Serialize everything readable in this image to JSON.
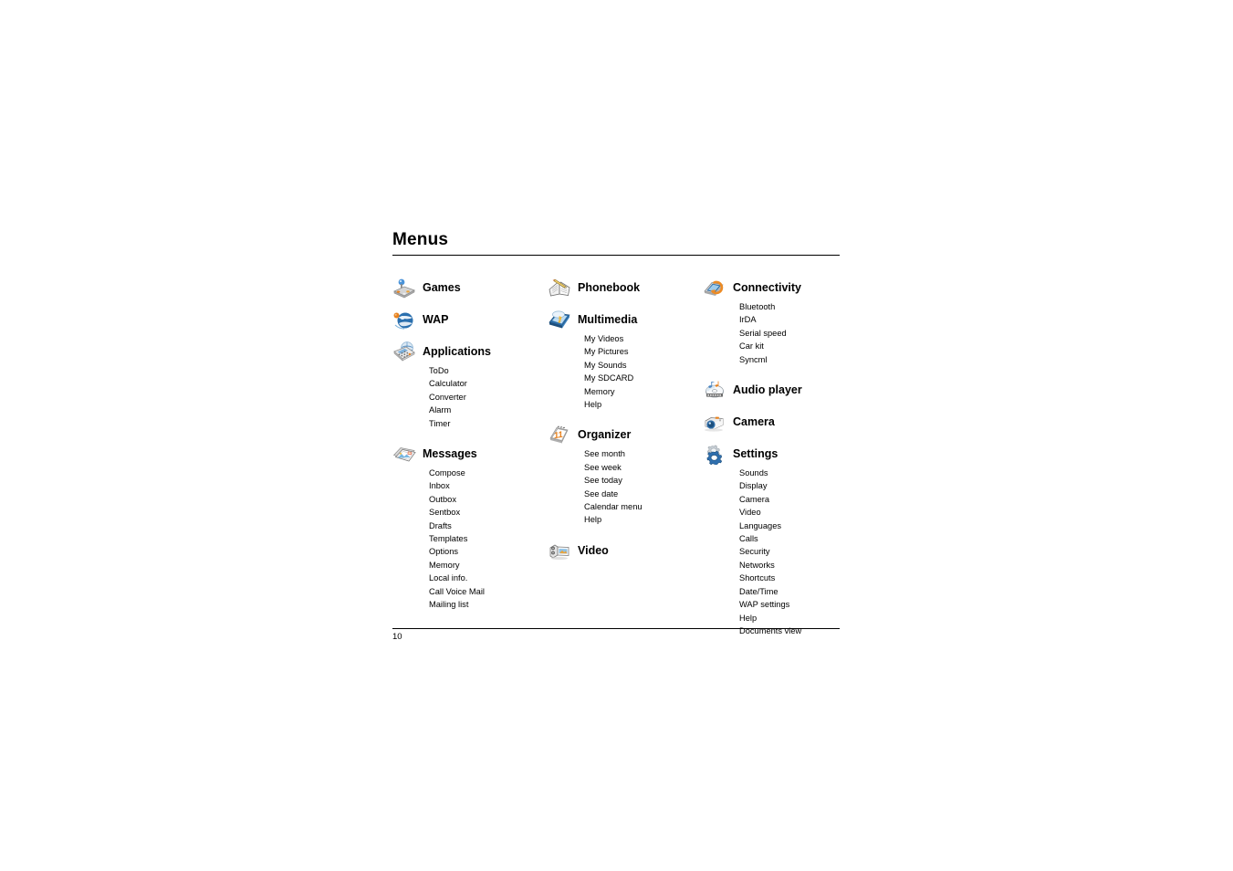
{
  "document": {
    "title": "Menus",
    "page_number": "10"
  },
  "columns": [
    {
      "name": "column-1",
      "groups": [
        {
          "icon": "joystick-icon",
          "label": "Games",
          "items": []
        },
        {
          "icon": "globe-icon",
          "label": "WAP",
          "items": []
        },
        {
          "icon": "calculator-icon",
          "label": "Applications",
          "items": [
            "ToDo",
            "Calculator",
            "Converter",
            "Alarm",
            "Timer"
          ]
        },
        {
          "icon": "messages-icon",
          "label": "Messages",
          "items": [
            "Compose",
            "Inbox",
            "Outbox",
            "Sentbox",
            "Drafts",
            "Templates",
            "Options",
            "Memory",
            "Local info.",
            "Call Voice Mail",
            "Mailing list"
          ]
        }
      ]
    },
    {
      "name": "column-2",
      "groups": [
        {
          "icon": "address-book-icon",
          "label": "Phonebook",
          "items": []
        },
        {
          "icon": "multimedia-icon",
          "label": "Multimedia",
          "items": [
            "My Videos",
            "My Pictures",
            "My Sounds",
            "My SDCARD",
            "Memory",
            "Help"
          ]
        },
        {
          "icon": "calendar-icon",
          "label": "Organizer",
          "items": [
            "See month",
            "See week",
            "See today",
            "See date",
            "Calendar menu",
            "Help"
          ]
        },
        {
          "icon": "camcorder-icon",
          "label": "Video",
          "items": []
        }
      ]
    },
    {
      "name": "column-3",
      "groups": [
        {
          "icon": "connectivity-icon",
          "label": "Connectivity",
          "items": [
            "Bluetooth",
            "IrDA",
            "Serial speed",
            "Car kit",
            "Syncml"
          ]
        },
        {
          "icon": "cd-music-icon",
          "label": "Audio player",
          "items": []
        },
        {
          "icon": "camera-icon",
          "label": "Camera",
          "items": []
        },
        {
          "icon": "gears-icon",
          "label": "Settings",
          "items": [
            "Sounds",
            "Display",
            "Camera",
            "Video",
            "Languages",
            "Calls",
            "Security",
            "Networks",
            "Shortcuts",
            "Date/Time",
            "WAP settings",
            "Help",
            "Documents view"
          ]
        }
      ]
    }
  ],
  "colors": {
    "text": "#000000",
    "rule": "#000000",
    "icon_blue": "#2e6da8",
    "icon_light_blue": "#8fc3e8",
    "icon_orange": "#e8811c",
    "icon_grey": "#b5b5b5"
  }
}
